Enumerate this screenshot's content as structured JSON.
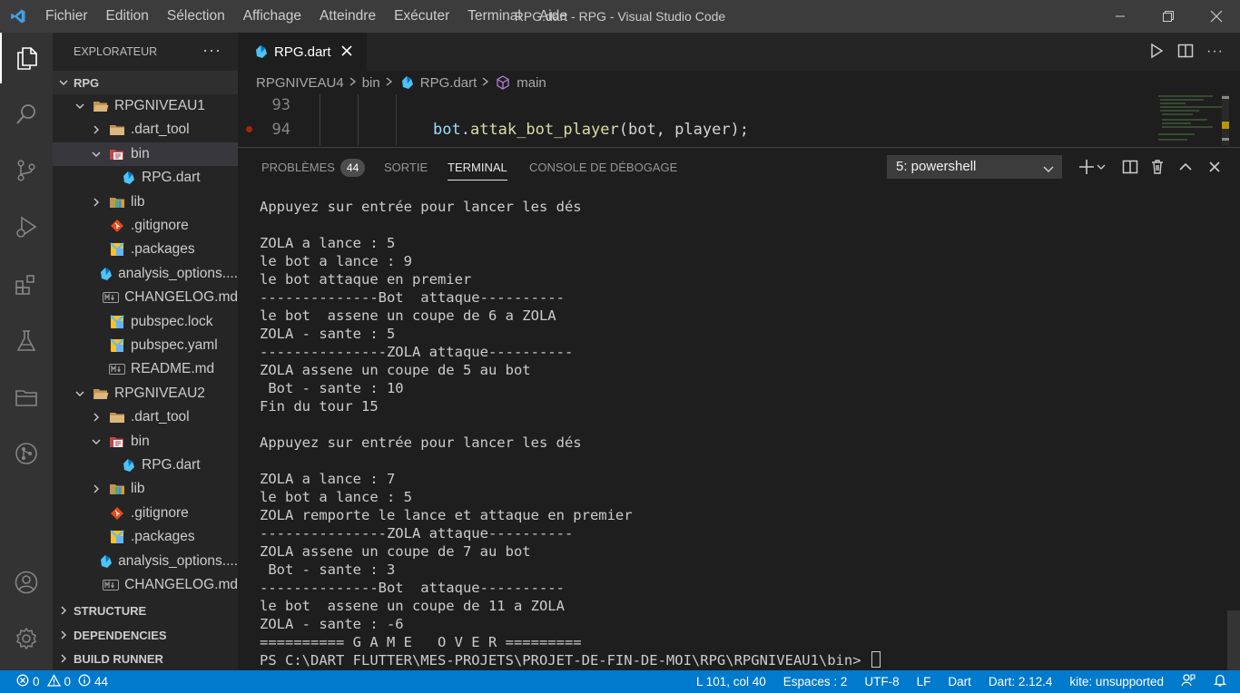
{
  "window": {
    "title": "RPG.dart - RPG - Visual Studio Code"
  },
  "menu": [
    "Fichier",
    "Edition",
    "Sélection",
    "Affichage",
    "Atteindre",
    "Exécuter",
    "Terminal",
    "Aide"
  ],
  "sidebar": {
    "header": "EXPLORATEUR",
    "root": "RPG",
    "tree": [
      {
        "label": "RPGNIVEAU1",
        "kind": "folder-open"
      },
      {
        "label": ".dart_tool",
        "kind": "folder"
      },
      {
        "label": "bin",
        "kind": "bin-open"
      },
      {
        "label": "RPG.dart",
        "kind": "dart"
      },
      {
        "label": "lib",
        "kind": "lib"
      },
      {
        "label": ".gitignore",
        "kind": "git"
      },
      {
        "label": ".packages",
        "kind": "package"
      },
      {
        "label": "analysis_options....",
        "kind": "dart"
      },
      {
        "label": "CHANGELOG.md",
        "kind": "md"
      },
      {
        "label": "pubspec.lock",
        "kind": "package"
      },
      {
        "label": "pubspec.yaml",
        "kind": "package"
      },
      {
        "label": "README.md",
        "kind": "md"
      },
      {
        "label": "RPGNIVEAU2",
        "kind": "folder-open"
      },
      {
        "label": ".dart_tool",
        "kind": "folder"
      },
      {
        "label": "bin",
        "kind": "bin-open"
      },
      {
        "label": "RPG.dart",
        "kind": "dart"
      },
      {
        "label": "lib",
        "kind": "lib"
      },
      {
        "label": ".gitignore",
        "kind": "git"
      },
      {
        "label": ".packages",
        "kind": "package"
      },
      {
        "label": "analysis_options....",
        "kind": "dart"
      },
      {
        "label": "CHANGELOG.md",
        "kind": "md"
      }
    ],
    "sections": [
      "STRUCTURE",
      "DEPENDENCIES",
      "BUILD RUNNER"
    ]
  },
  "editor": {
    "tab": "RPG.dart",
    "breadcrumb": [
      "RPGNIVEAU4",
      "bin",
      "RPG.dart",
      "main"
    ],
    "lines": [
      {
        "num": "93",
        "code": ""
      },
      {
        "num": "94",
        "obj": "bot",
        "dot": ".",
        "method": "attak_bot_player",
        "args": "(bot, player);"
      }
    ]
  },
  "panel": {
    "tabs": {
      "problems": "PROBLÈMES",
      "problems_count": "44",
      "output": "SORTIE",
      "terminal": "TERMINAL",
      "debug": "CONSOLE DE DÉBOGAGE"
    },
    "terminal_select": "5: powershell",
    "terminal_lines": [
      "Appuyez sur entrée pour lancer les dés",
      "",
      "ZOLA a lance : 5",
      "le bot a lance : 9",
      "le bot attaque en premier",
      "--------------Bot  attaque----------",
      "le bot  assene un coupe de 6 a ZOLA",
      "ZOLA - sante : 5",
      "---------------ZOLA attaque----------",
      "ZOLA assene un coupe de 5 au bot",
      " Bot - sante : 10",
      "Fin du tour 15",
      "",
      "Appuyez sur entrée pour lancer les dés",
      "",
      "ZOLA a lance : 7",
      "le bot a lance : 5",
      "ZOLA remporte le lance et attaque en premier",
      "---------------ZOLA attaque----------",
      "ZOLA assene un coupe de 7 au bot",
      " Bot - sante : 3",
      "--------------Bot  attaque----------",
      "le bot  assene un coupe de 11 a ZOLA",
      "ZOLA - sante : -6",
      "========== G A M E   O V E R =========",
      "PS C:\\DART FLUTTER\\MES-PROJETS\\PROJET-DE-FIN-DE-MOI\\RPG\\RPGNIVEAU1\\bin> "
    ]
  },
  "status": {
    "errors": "0",
    "warnings": "0",
    "infos": "44",
    "position": "L 101, col 40",
    "spaces": "Espaces : 2",
    "encoding": "UTF-8",
    "eol": "LF",
    "language": "Dart",
    "sdk": "Dart: 2.12.4",
    "kite": "kite: unsupported"
  },
  "colors": {
    "accent": "#007acc",
    "dart": "#4fc3f7",
    "method": "#4ec9b0",
    "obj": "#9cdcfe"
  }
}
